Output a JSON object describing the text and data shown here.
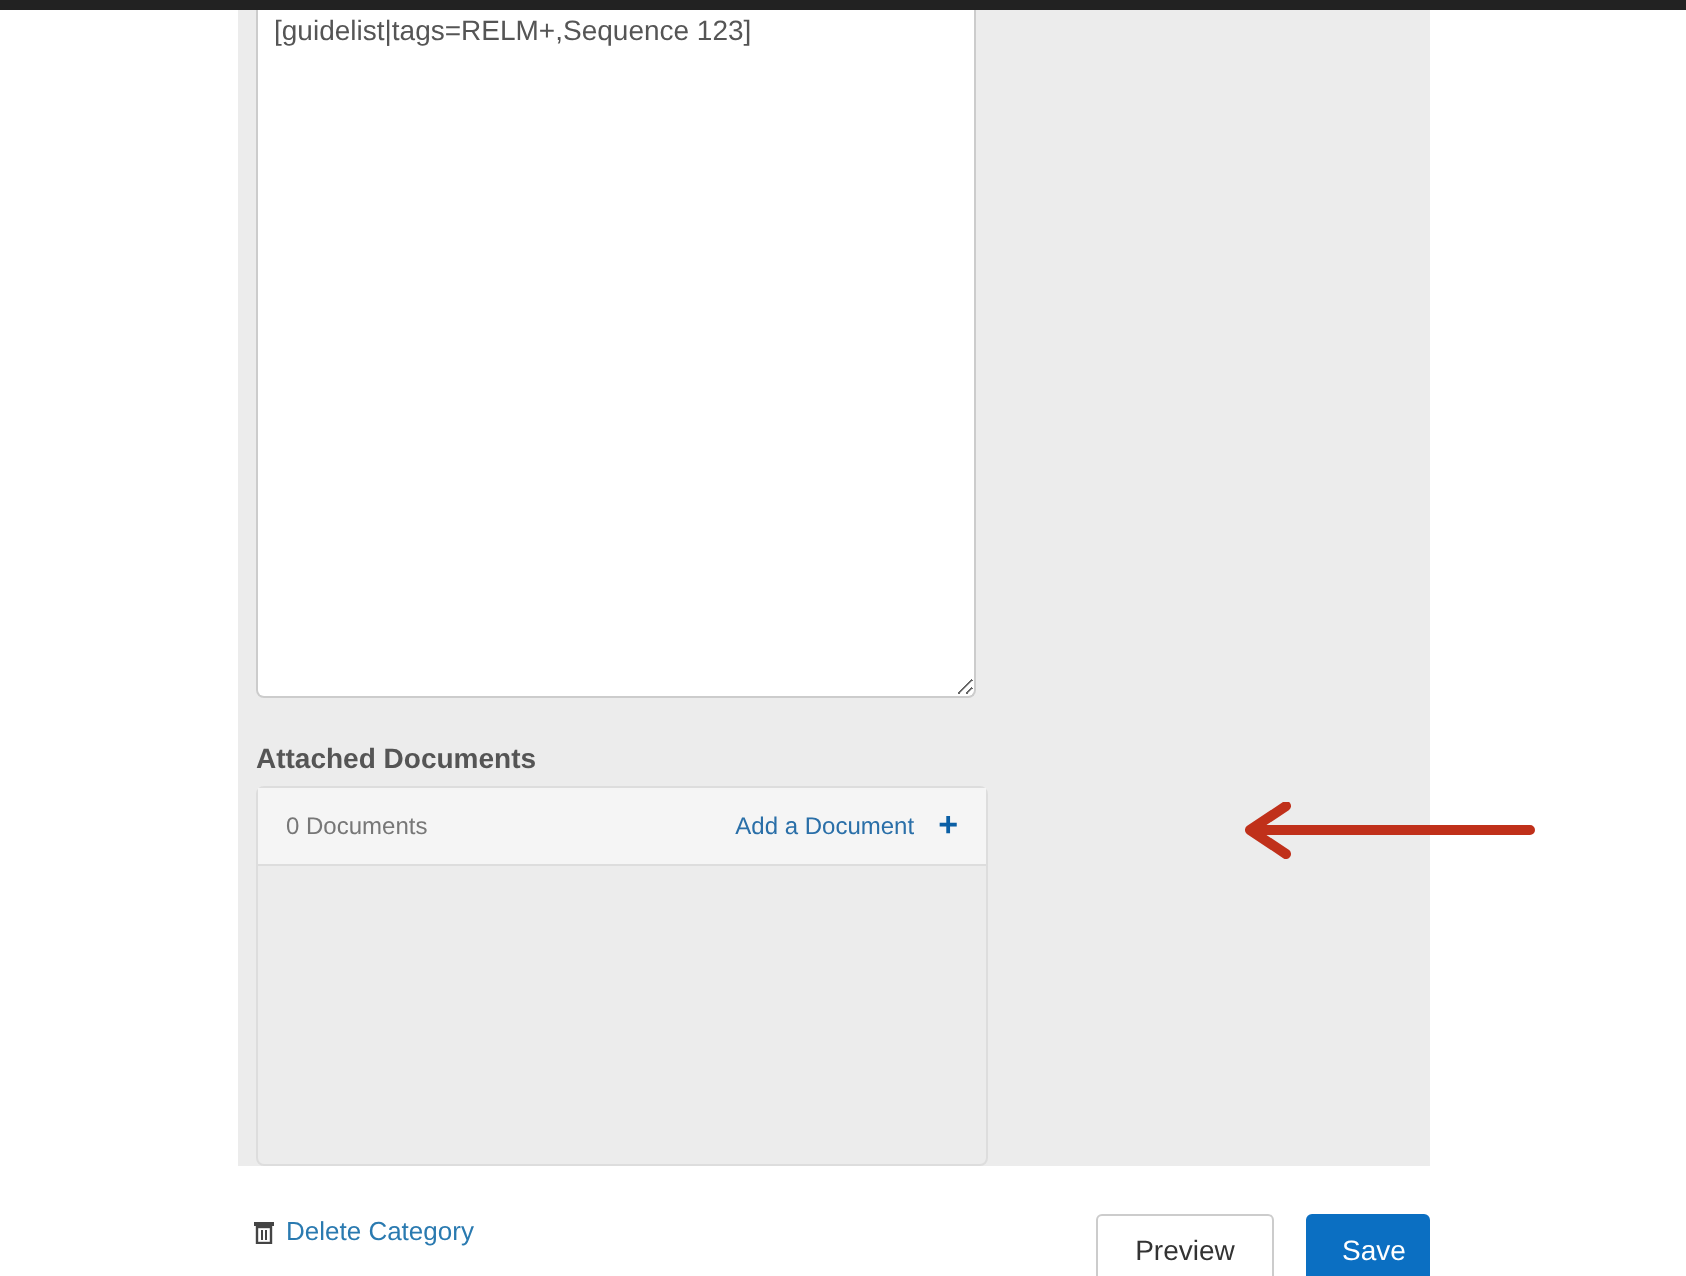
{
  "editor": {
    "value": "[guidelist|tags=RELM+,Sequence 123]"
  },
  "attached_documents": {
    "heading": "Attached Documents",
    "count": "0 Documents",
    "add_link": "Add a Document",
    "add_icon": "+"
  },
  "footer": {
    "delete_link": "Delete Category",
    "buttons": [
      {
        "label": "Preview",
        "kind": "secondary"
      },
      {
        "label": "Save",
        "kind": "primary"
      }
    ]
  }
}
